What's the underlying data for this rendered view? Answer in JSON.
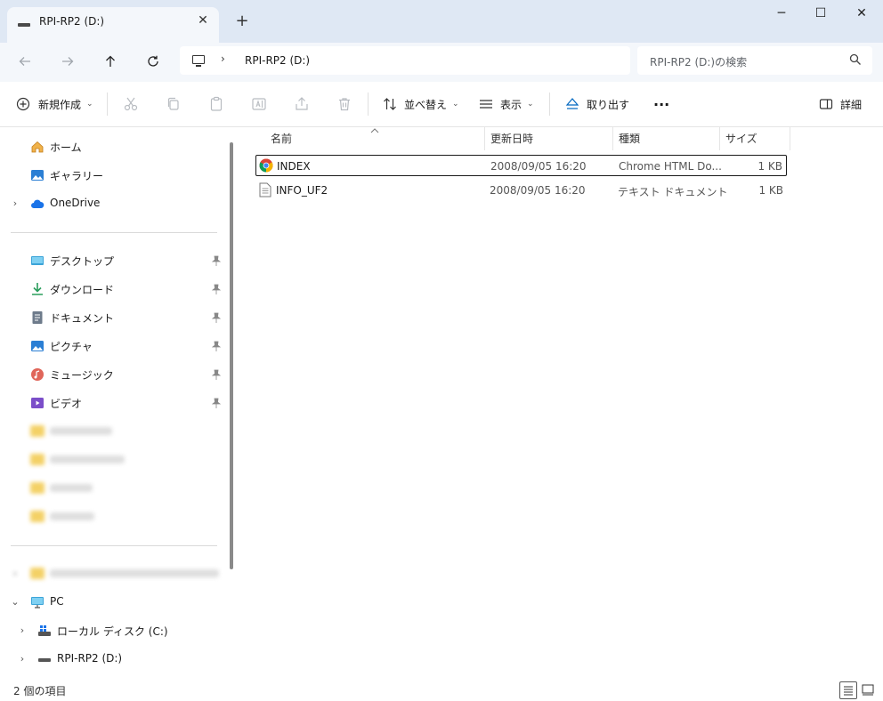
{
  "window": {
    "tab_title": "RPI-RP2 (D:)",
    "tab_close": "✕",
    "new_tab": "+",
    "minimize": "─",
    "maximize": "☐",
    "close": "✕"
  },
  "address": {
    "path": "RPI-RP2 (D:)",
    "separator": "›",
    "search_placeholder": "RPI-RP2 (D:)の検索"
  },
  "toolbar": {
    "new_label": "新規作成",
    "sort_label": "並べ替え",
    "view_label": "表示",
    "eject_label": "取り出す",
    "more_label": "···",
    "details_label": "詳細"
  },
  "sidebar": {
    "quick": [
      {
        "label": "ホーム"
      },
      {
        "label": "ギャラリー"
      },
      {
        "label": "OneDrive"
      }
    ],
    "pinned": [
      {
        "label": "デスクトップ"
      },
      {
        "label": "ダウンロード"
      },
      {
        "label": "ドキュメント"
      },
      {
        "label": "ピクチャ"
      },
      {
        "label": "ミュージック"
      },
      {
        "label": "ビデオ"
      }
    ],
    "pc": {
      "label": "PC"
    },
    "drives": [
      {
        "label": "ローカル ディスク (C:)"
      },
      {
        "label": "RPI-RP2 (D:)"
      }
    ]
  },
  "filelist": {
    "columns": {
      "name": "名前",
      "date": "更新日時",
      "type": "種類",
      "size": "サイズ"
    },
    "rows": [
      {
        "name": "INDEX",
        "date": "2008/09/05 16:20",
        "type": "Chrome HTML Do...",
        "size": "1 KB"
      },
      {
        "name": "INFO_UF2",
        "date": "2008/09/05 16:20",
        "type": "テキスト ドキュメント",
        "size": "1 KB"
      }
    ]
  },
  "status": {
    "count": "2 個の項目"
  },
  "colors": {
    "titlebar": "#dfe8f4",
    "addrbar": "#f4f7fb",
    "accent": "#0067c0"
  }
}
